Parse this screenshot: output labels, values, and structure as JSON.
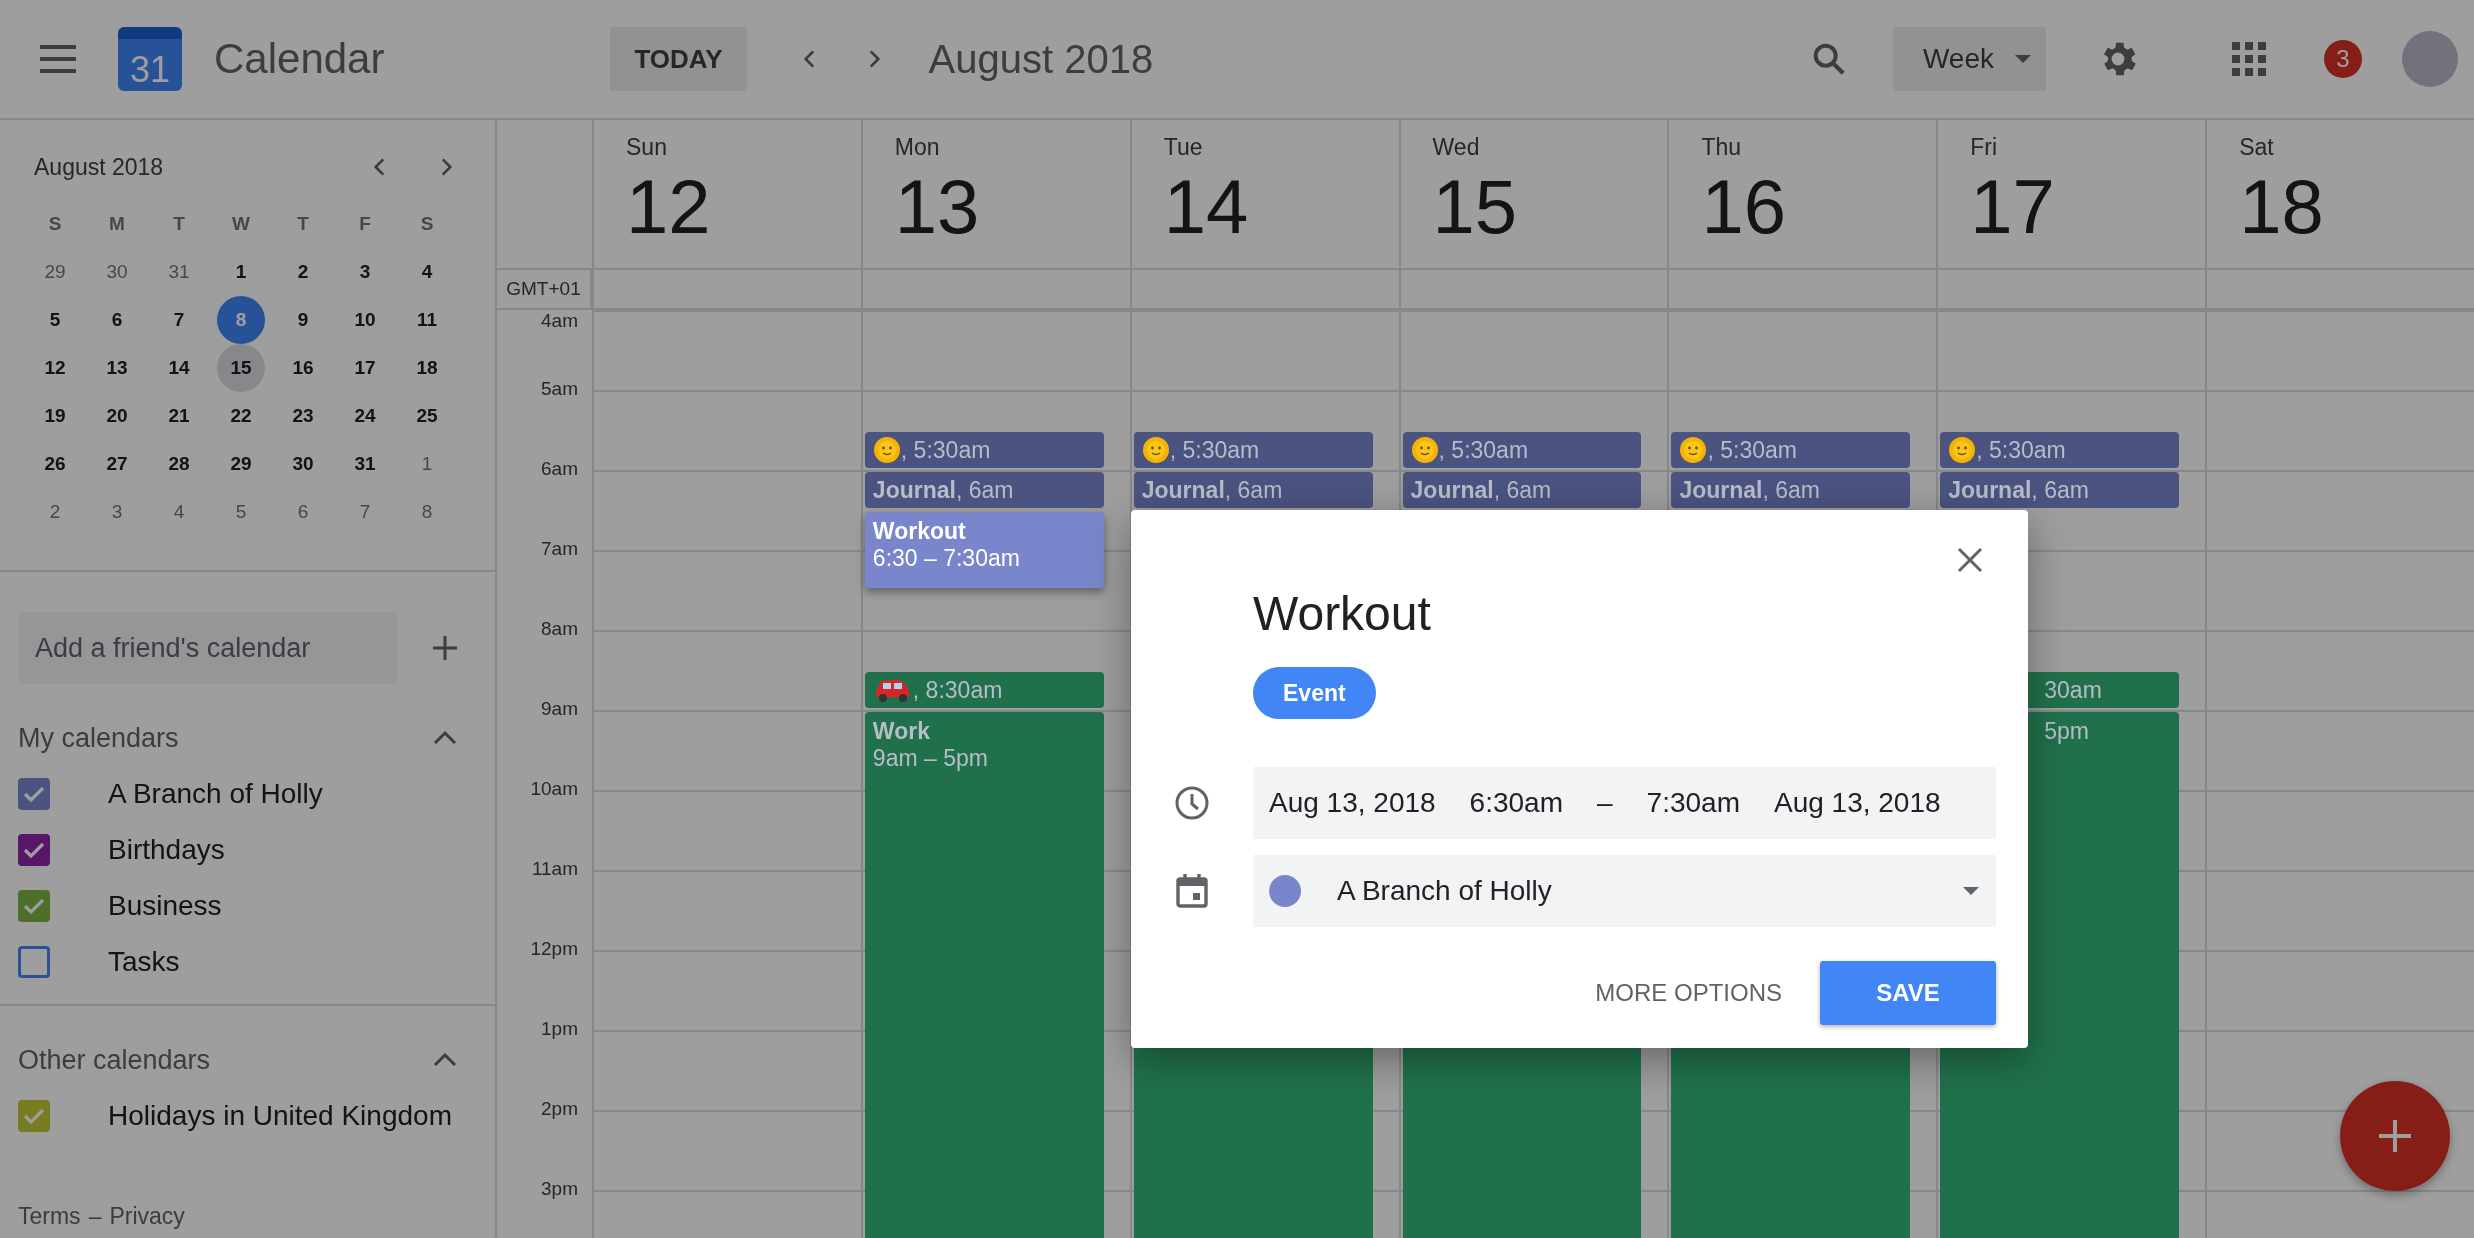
{
  "topbar": {
    "logo_day": "31",
    "app_name": "Calendar",
    "today_button": "TODAY",
    "period": "August 2018",
    "view": "Week",
    "notifications": "3"
  },
  "mini_calendar": {
    "title": "August 2018",
    "weekdays": [
      "S",
      "M",
      "T",
      "W",
      "T",
      "F",
      "S"
    ],
    "days": [
      {
        "label": "29",
        "in_month": false,
        "today": false,
        "selected": false
      },
      {
        "label": "30",
        "in_month": false,
        "today": false,
        "selected": false
      },
      {
        "label": "31",
        "in_month": false,
        "today": false,
        "selected": false
      },
      {
        "label": "1",
        "in_month": true,
        "today": false,
        "selected": false
      },
      {
        "label": "2",
        "in_month": true,
        "today": false,
        "selected": false
      },
      {
        "label": "3",
        "in_month": true,
        "today": false,
        "selected": false
      },
      {
        "label": "4",
        "in_month": true,
        "today": false,
        "selected": false
      },
      {
        "label": "5",
        "in_month": true,
        "today": false,
        "selected": false
      },
      {
        "label": "6",
        "in_month": true,
        "today": false,
        "selected": false
      },
      {
        "label": "7",
        "in_month": true,
        "today": false,
        "selected": false
      },
      {
        "label": "8",
        "in_month": true,
        "today": true,
        "selected": false
      },
      {
        "label": "9",
        "in_month": true,
        "today": false,
        "selected": false
      },
      {
        "label": "10",
        "in_month": true,
        "today": false,
        "selected": false
      },
      {
        "label": "11",
        "in_month": true,
        "today": false,
        "selected": false
      },
      {
        "label": "12",
        "in_month": true,
        "today": false,
        "selected": false
      },
      {
        "label": "13",
        "in_month": true,
        "today": false,
        "selected": false
      },
      {
        "label": "14",
        "in_month": true,
        "today": false,
        "selected": false
      },
      {
        "label": "15",
        "in_month": true,
        "today": false,
        "selected": true
      },
      {
        "label": "16",
        "in_month": true,
        "today": false,
        "selected": false
      },
      {
        "label": "17",
        "in_month": true,
        "today": false,
        "selected": false
      },
      {
        "label": "18",
        "in_month": true,
        "today": false,
        "selected": false
      },
      {
        "label": "19",
        "in_month": true,
        "today": false,
        "selected": false
      },
      {
        "label": "20",
        "in_month": true,
        "today": false,
        "selected": false
      },
      {
        "label": "21",
        "in_month": true,
        "today": false,
        "selected": false
      },
      {
        "label": "22",
        "in_month": true,
        "today": false,
        "selected": false
      },
      {
        "label": "23",
        "in_month": true,
        "today": false,
        "selected": false
      },
      {
        "label": "24",
        "in_month": true,
        "today": false,
        "selected": false
      },
      {
        "label": "25",
        "in_month": true,
        "today": false,
        "selected": false
      },
      {
        "label": "26",
        "in_month": true,
        "today": false,
        "selected": false
      },
      {
        "label": "27",
        "in_month": true,
        "today": false,
        "selected": false
      },
      {
        "label": "28",
        "in_month": true,
        "today": false,
        "selected": false
      },
      {
        "label": "29",
        "in_month": true,
        "today": false,
        "selected": false
      },
      {
        "label": "30",
        "in_month": true,
        "today": false,
        "selected": false
      },
      {
        "label": "31",
        "in_month": true,
        "today": false,
        "selected": false
      },
      {
        "label": "1",
        "in_month": false,
        "today": false,
        "selected": false
      },
      {
        "label": "2",
        "in_month": false,
        "today": false,
        "selected": false
      },
      {
        "label": "3",
        "in_month": false,
        "today": false,
        "selected": false
      },
      {
        "label": "4",
        "in_month": false,
        "today": false,
        "selected": false
      },
      {
        "label": "5",
        "in_month": false,
        "today": false,
        "selected": false
      },
      {
        "label": "6",
        "in_month": false,
        "today": false,
        "selected": false
      },
      {
        "label": "7",
        "in_month": false,
        "today": false,
        "selected": false
      },
      {
        "label": "8",
        "in_month": false,
        "today": false,
        "selected": false
      }
    ]
  },
  "add_calendar": {
    "placeholder": "Add a friend's calendar"
  },
  "calendar_groups": [
    {
      "title": "My calendars",
      "expanded": true,
      "items": [
        {
          "name": "A Branch of Holly",
          "checked": true,
          "color": "#4b5380"
        },
        {
          "name": "Birthdays",
          "checked": true,
          "color": "#581669"
        },
        {
          "name": "Business",
          "checked": true,
          "color": "#4d6f29"
        },
        {
          "name": "Tasks",
          "checked": false,
          "color": "#295297"
        }
      ]
    },
    {
      "title": "Other calendars",
      "expanded": true,
      "items": [
        {
          "name": "Holidays in United Kingdom",
          "checked": true,
          "color": "#777d20"
        }
      ]
    }
  ],
  "footer": {
    "terms": "Terms",
    "separator": "–",
    "privacy": "Privacy"
  },
  "week": {
    "timezone": "GMT+01",
    "hours": [
      "4am",
      "5am",
      "6am",
      "7am",
      "8am",
      "9am",
      "10am",
      "11am",
      "12pm",
      "1pm",
      "2pm",
      "3pm"
    ],
    "days": [
      {
        "weekday": "Sun",
        "date": "12"
      },
      {
        "weekday": "Mon",
        "date": "13",
        "events": [
          {
            "kind": "sunrise",
            "label": ", 5:30am",
            "color": "#4b5380",
            "selected": false
          },
          {
            "kind": "journal",
            "label": "**Journal**, 6am",
            "color": "#4b5380",
            "selected": false
          },
          {
            "kind": "workout",
            "title": "Workout",
            "time": "6:30 – 7:30am",
            "color": "#7986cb",
            "selected": true
          },
          {
            "kind": "drive",
            "label": ", 8:30am",
            "color": "#20714b",
            "selected": false
          },
          {
            "kind": "work",
            "title": "Work",
            "time": "9am – 5pm",
            "color": "#20714b",
            "selected": false
          }
        ]
      },
      {
        "weekday": "Tue",
        "date": "14",
        "events": [
          {
            "kind": "sunrise",
            "label": ", 5:30am",
            "color": "#4b5380",
            "selected": false
          },
          {
            "kind": "journal",
            "label": "**Journal**, 6am",
            "color": "#4b5380",
            "selected": false
          },
          {
            "kind": "work",
            "color": "#20714b",
            "selected": false
          }
        ]
      },
      {
        "weekday": "Wed",
        "date": "15",
        "events": [
          {
            "kind": "sunrise",
            "label": ", 5:30am",
            "color": "#4b5380",
            "selected": false
          },
          {
            "kind": "journal",
            "label": "**Journal**, 6am",
            "color": "#4b5380",
            "selected": false
          },
          {
            "kind": "work",
            "color": "#20714b",
            "selected": false
          }
        ]
      },
      {
        "weekday": "Thu",
        "date": "16",
        "events": [
          {
            "kind": "sunrise",
            "label": ", 5:30am",
            "color": "#4b5380",
            "selected": false
          },
          {
            "kind": "journal",
            "label": "**Journal**, 6am",
            "color": "#4b5380",
            "selected": false
          },
          {
            "kind": "work",
            "color": "#20714b",
            "selected": false
          }
        ]
      },
      {
        "weekday": "Fri",
        "date": "17",
        "events": [
          {
            "kind": "sunrise",
            "label": ", 5:30am",
            "color": "#4b5380",
            "selected": false
          },
          {
            "kind": "journal",
            "label": "**Journal**, 6am",
            "color": "#4b5380",
            "selected": false
          },
          {
            "kind": "drive",
            "label": "30am",
            "color": "#20714b",
            "selected": false
          },
          {
            "kind": "work",
            "time": "5pm",
            "color": "#20714b",
            "selected": false
          }
        ]
      },
      {
        "weekday": "Sat",
        "date": "18"
      }
    ]
  },
  "dialog": {
    "title": "Workout",
    "type_chip": "Event",
    "start_date": "Aug 13, 2018",
    "start_time": "6:30am",
    "dash": "–",
    "end_time": "7:30am",
    "end_date": "Aug 13, 2018",
    "calendar": {
      "name": "A Branch of Holly",
      "color": "#7986cb"
    },
    "more_options": "MORE OPTIONS",
    "save": "SAVE"
  }
}
